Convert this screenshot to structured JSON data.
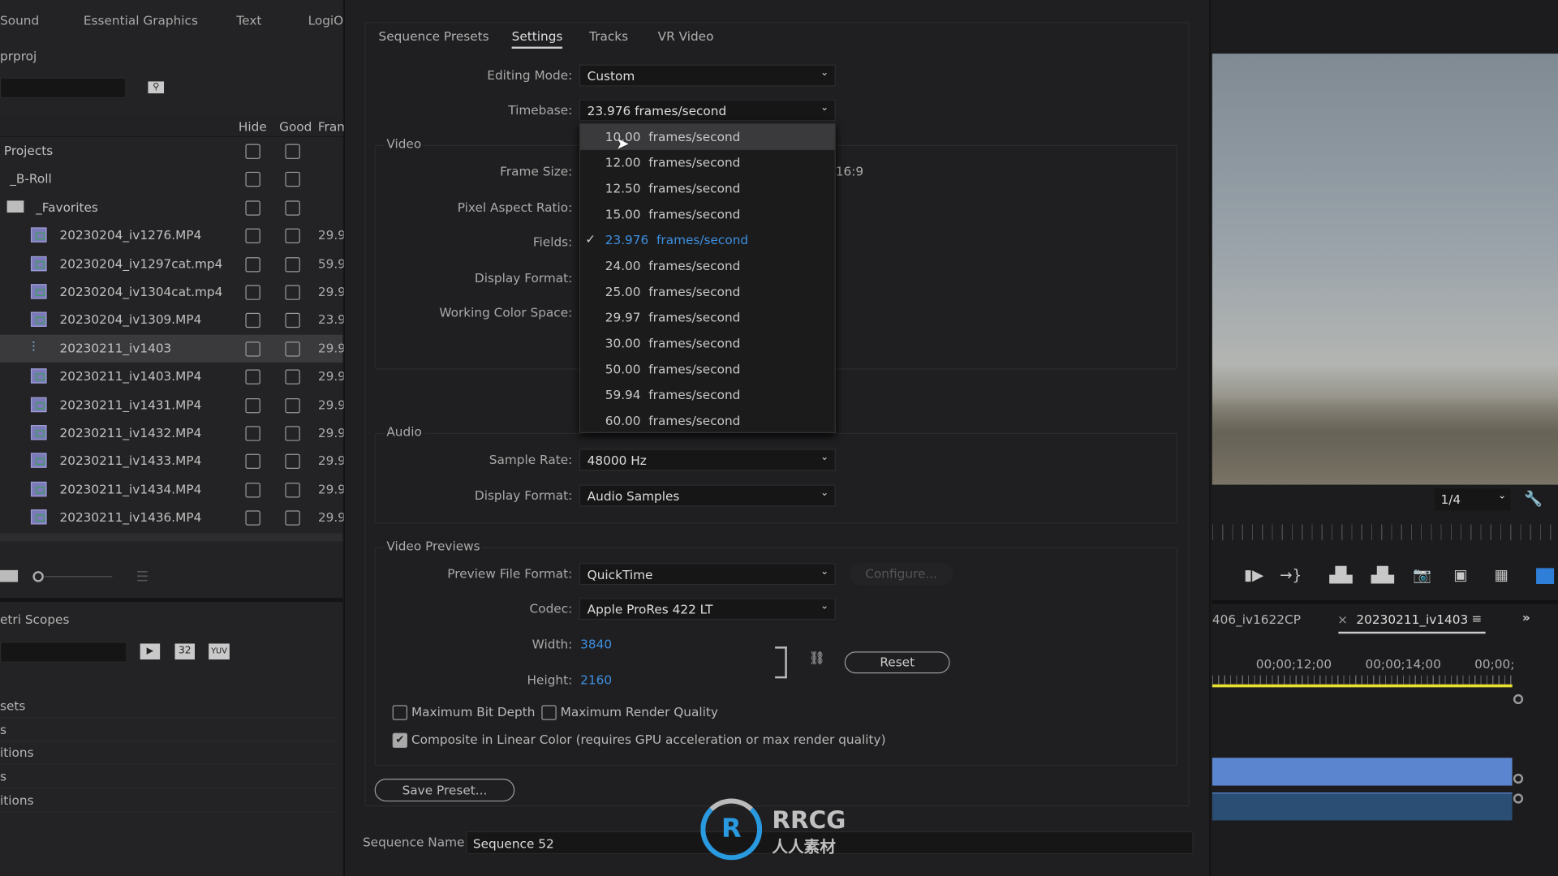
{
  "workspace_tabs": [
    "Sound",
    "Essential Graphics",
    "Text",
    "LogiO"
  ],
  "project": {
    "name": "prproj",
    "columns": [
      "Hide",
      "Good",
      "Fram"
    ],
    "items": [
      {
        "name": "Projects",
        "type": "bin",
        "fps": ""
      },
      {
        "name": "_B-Roll",
        "type": "bin",
        "fps": ""
      },
      {
        "name": "_Favorites",
        "type": "folder",
        "fps": ""
      },
      {
        "name": "20230204_iv1276.MP4",
        "type": "clip",
        "fps": "29.9"
      },
      {
        "name": "20230204_iv1297cat.mp4",
        "type": "clip",
        "fps": "59.9"
      },
      {
        "name": "20230204_iv1304cat.mp4",
        "type": "clip",
        "fps": "29.9"
      },
      {
        "name": "20230204_iv1309.MP4",
        "type": "clip",
        "fps": "23.9"
      },
      {
        "name": "20230211_iv1403",
        "type": "sequence",
        "fps": "29.9",
        "selected": true
      },
      {
        "name": "20230211_iv1403.MP4",
        "type": "clip",
        "fps": "29.9"
      },
      {
        "name": "20230211_iv1431.MP4",
        "type": "clip",
        "fps": "29.9"
      },
      {
        "name": "20230211_iv1432.MP4",
        "type": "clip",
        "fps": "29.9"
      },
      {
        "name": "20230211_iv1433.MP4",
        "type": "clip",
        "fps": "29.9"
      },
      {
        "name": "20230211_iv1434.MP4",
        "type": "clip",
        "fps": "29.9"
      },
      {
        "name": "20230211_iv1436.MP4",
        "type": "clip",
        "fps": "29.9"
      }
    ]
  },
  "lumetri": {
    "title": "etri Scopes",
    "buttons": [
      "",
      "32",
      "YUV"
    ],
    "list": [
      "sets",
      "s",
      "itions",
      "s",
      "itions"
    ]
  },
  "dialog": {
    "tabs": [
      "Sequence Presets",
      "Settings",
      "Tracks",
      "VR Video"
    ],
    "active_tab": "Settings",
    "editing_mode": {
      "label": "Editing Mode:",
      "value": "Custom"
    },
    "timebase": {
      "label": "Timebase:",
      "value": "23.976  frames/second"
    },
    "video": {
      "title": "Video",
      "frame_size": "Frame Size:",
      "frame_size_tail": "16:9",
      "pixel_aspect": "Pixel Aspect Ratio:",
      "fields": "Fields:",
      "display_format": "Display Format:",
      "color_space": "Working Color Space:"
    },
    "timebase_options": [
      {
        "value": "10.00",
        "unit": "frames/second",
        "hover": true
      },
      {
        "value": "12.00",
        "unit": "frames/second"
      },
      {
        "value": "12.50",
        "unit": "frames/second"
      },
      {
        "value": "15.00",
        "unit": "frames/second"
      },
      {
        "value": "23.976",
        "unit": "frames/second",
        "selected": true
      },
      {
        "value": "24.00",
        "unit": "frames/second"
      },
      {
        "value": "25.00",
        "unit": "frames/second"
      },
      {
        "value": "29.97",
        "unit": "frames/second"
      },
      {
        "value": "30.00",
        "unit": "frames/second"
      },
      {
        "value": "50.00",
        "unit": "frames/second"
      },
      {
        "value": "59.94",
        "unit": "frames/second"
      },
      {
        "value": "60.00",
        "unit": "frames/second"
      }
    ],
    "audio": {
      "title": "Audio",
      "sample_rate_label": "Sample Rate:",
      "sample_rate": "48000 Hz",
      "display_format_label": "Display Format:",
      "display_format": "Audio Samples"
    },
    "previews": {
      "title": "Video Previews",
      "format_label": "Preview File Format:",
      "format": "QuickTime",
      "configure": "Configure...",
      "codec_label": "Codec:",
      "codec": "Apple ProRes 422 LT",
      "width_label": "Width:",
      "width": "3840",
      "height_label": "Height:",
      "height": "2160",
      "reset": "Reset",
      "max_bit_depth": "Maximum Bit Depth",
      "max_render_quality": "Maximum Render Quality",
      "linear_color": "Composite in Linear Color (requires GPU acceleration or max render quality)"
    },
    "save_preset": "Save Preset...",
    "sequence_name_label": "Sequence Name:",
    "sequence_name": "Sequence 52"
  },
  "monitor": {
    "zoom": "1/4"
  },
  "timeline": {
    "tabs": [
      "406_iv1622CP",
      "20230211_iv1403"
    ],
    "timecodes": [
      "00;00;12;00",
      "00;00;14;00",
      "00;00;"
    ]
  },
  "watermark": {
    "text": "RRCG",
    "sub": "人人素材"
  },
  "colors": {
    "accent": "#3d8fe0",
    "playhead": "#e8e030",
    "clip": "#5b86cf"
  }
}
